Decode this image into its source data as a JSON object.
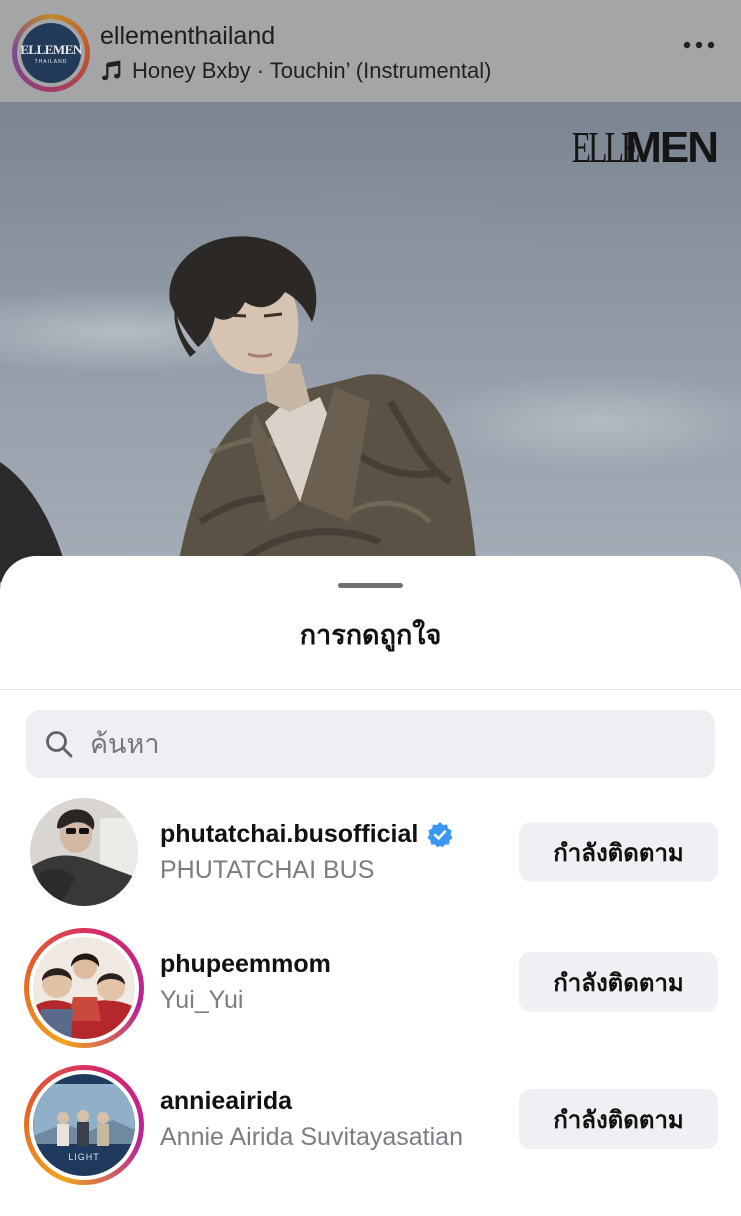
{
  "post": {
    "username": "ellementhailand",
    "music": "Honey Bxby · Touchin’ (Instrumental)",
    "avatar_logo": "ELLEMEN",
    "avatar_logo_sub": "THAILAND",
    "brand_logo_left": "ELLE",
    "brand_logo_right": "MEN"
  },
  "sheet": {
    "title": "การกดถูกใจ",
    "search_placeholder": "ค้นหา"
  },
  "likers": [
    {
      "username": "phutatchai.busofficial",
      "full_name": "PHUTATCHAI BUS",
      "verified": true,
      "story_ring": false,
      "button": "กำลังติดตาม"
    },
    {
      "username": "phupeemmom",
      "full_name": "Yui_Yui",
      "verified": false,
      "story_ring": true,
      "button": "กำลังติดตาม"
    },
    {
      "username": "annieairida",
      "full_name": "Annie Airida Suvitayasatian",
      "verified": false,
      "story_ring": true,
      "button": "กำลังติดตาม"
    }
  ],
  "colors": {
    "verified_badge": "#3897f0",
    "ring_start": "#f1a31b",
    "ring_end": "#b6249a"
  }
}
